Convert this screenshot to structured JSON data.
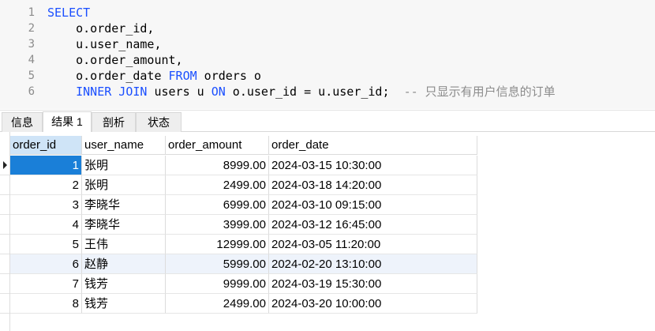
{
  "editor": {
    "lines": [
      {
        "num": "1",
        "parts": [
          {
            "t": "SELECT",
            "c": "kw"
          }
        ]
      },
      {
        "num": "2",
        "parts": [
          {
            "t": "    o.order_id,",
            "c": ""
          }
        ]
      },
      {
        "num": "3",
        "parts": [
          {
            "t": "    u.user_name,",
            "c": ""
          }
        ]
      },
      {
        "num": "4",
        "parts": [
          {
            "t": "    o.order_amount,",
            "c": ""
          }
        ]
      },
      {
        "num": "5",
        "parts": [
          {
            "t": "    o.order_date ",
            "c": ""
          },
          {
            "t": "FROM",
            "c": "kw"
          },
          {
            "t": " orders o",
            "c": ""
          }
        ]
      },
      {
        "num": "6",
        "parts": [
          {
            "t": "    ",
            "c": ""
          },
          {
            "t": "INNER JOIN",
            "c": "kw"
          },
          {
            "t": " users u ",
            "c": ""
          },
          {
            "t": "ON",
            "c": "kw"
          },
          {
            "t": " o.user_id = u.user_id;  ",
            "c": ""
          },
          {
            "t": "-- 只显示有用户信息的订单",
            "c": "cm"
          }
        ]
      }
    ]
  },
  "tabs": [
    {
      "label": "信息",
      "active": false
    },
    {
      "label": "结果 1",
      "active": true
    },
    {
      "label": "剖析",
      "active": false
    },
    {
      "label": "状态",
      "active": false
    }
  ],
  "grid": {
    "columns": [
      "order_id",
      "user_name",
      "order_amount",
      "order_date"
    ],
    "rows": [
      [
        "1",
        "张明",
        "8999.00",
        "2024-03-15 10:30:00"
      ],
      [
        "2",
        "张明",
        "2499.00",
        "2024-03-18 14:20:00"
      ],
      [
        "3",
        "李晓华",
        "6999.00",
        "2024-03-10 09:15:00"
      ],
      [
        "4",
        "李晓华",
        "3999.00",
        "2024-03-12 16:45:00"
      ],
      [
        "5",
        "王伟",
        "12999.00",
        "2024-03-05 11:20:00"
      ],
      [
        "6",
        "赵静",
        "5999.00",
        "2024-02-20 13:10:00"
      ],
      [
        "7",
        "钱芳",
        "9999.00",
        "2024-03-19 15:30:00"
      ],
      [
        "8",
        "钱芳",
        "2499.00",
        "2024-03-20 10:00:00"
      ]
    ]
  },
  "colors": {
    "keyword": "#1a4fff",
    "comment": "#8c8c8c",
    "selected_cell": "#1a7fd8",
    "hover_row": "#eef3fb",
    "selected_header": "#cfe4f7"
  }
}
